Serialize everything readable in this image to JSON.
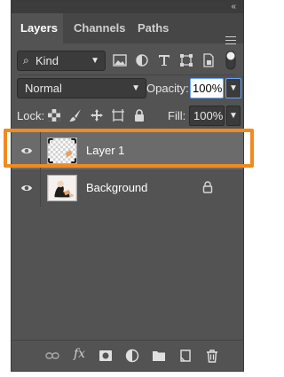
{
  "tabs": [
    {
      "label": "Layers",
      "active": true
    },
    {
      "label": "Channels",
      "active": false
    },
    {
      "label": "Paths",
      "active": false
    }
  ],
  "collapse_glyph": "«",
  "filter": {
    "kind_label": "Kind",
    "icons": [
      "image-filter-icon",
      "adjustment-filter-icon",
      "type-filter-icon",
      "shape-filter-icon",
      "smart-object-filter-icon",
      "filter-toggle"
    ]
  },
  "blend": {
    "mode": "Normal",
    "opacity_label": "Opacity:",
    "opacity_value": "100%"
  },
  "lock": {
    "label": "Lock:",
    "fill_label": "Fill:",
    "fill_value": "100%",
    "icons": [
      "lock-transparent-icon",
      "lock-image-icon",
      "lock-position-icon",
      "lock-artboard-icon",
      "lock-all-icon"
    ]
  },
  "layers": [
    {
      "name": "Layer 1",
      "selected": true,
      "visible": true,
      "locked": false
    },
    {
      "name": "Background",
      "selected": false,
      "visible": true,
      "locked": true
    }
  ],
  "footer_icons": [
    "link-icon",
    "fx-icon",
    "mask-icon",
    "adjustment-layer-icon",
    "group-folder-icon",
    "new-layer-icon",
    "trash-icon"
  ],
  "footer": {
    "fx_label": "fx"
  },
  "colors": {
    "panel_bg": "#535353",
    "selected_row": "#6b6b6b",
    "highlight": "#f28a1e",
    "focus_blue": "#6aa6ff"
  }
}
